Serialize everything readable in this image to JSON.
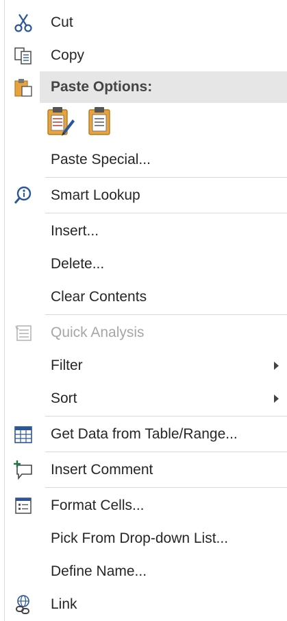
{
  "menu": {
    "cut": "Cut",
    "copy": "Copy",
    "paste_options": "Paste Options:",
    "paste_special": "Paste Special...",
    "smart_lookup": "Smart Lookup",
    "insert": "Insert...",
    "delete": "Delete...",
    "clear_contents": "Clear Contents",
    "quick_analysis": "Quick Analysis",
    "filter": "Filter",
    "sort": "Sort",
    "get_data": "Get Data from Table/Range...",
    "insert_comment": "Insert Comment",
    "format_cells": "Format Cells...",
    "pick_from_list": "Pick From Drop-down List...",
    "define_name": "Define Name...",
    "link": "Link"
  },
  "icons": {
    "cut": "scissors-icon",
    "copy": "copy-icon",
    "paste": "clipboard-icon",
    "paste_keep_format": "paste-keep-formatting-icon",
    "paste_values": "paste-values-icon",
    "smart_lookup": "smart-lookup-icon",
    "quick_analysis": "quick-analysis-icon",
    "table": "table-icon",
    "comment": "new-comment-icon",
    "format_cells": "format-cells-icon",
    "link": "link-icon"
  },
  "colors": {
    "accent_blue": "#2b579a",
    "comment_green": "#217346",
    "clipboard_orange": "#e8a33d",
    "disabled_gray": "#a6a6a6",
    "header_band": "#e6e6e6"
  }
}
